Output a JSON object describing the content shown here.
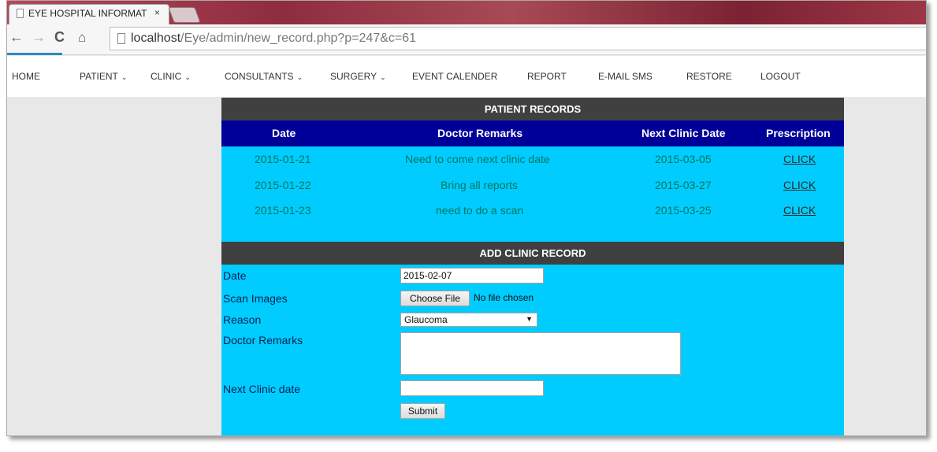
{
  "browser": {
    "tab_title": "EYE HOSPITAL INFORMAT",
    "tab_close": "×",
    "url_host": "localhost",
    "url_path": "/Eye/admin/new_record.php?p=247&c=61"
  },
  "nav": {
    "home": "HOME",
    "patient": "PATIENT",
    "clinic": "CLINIC",
    "consultants": "CONSULTANTS",
    "surgery": "SURGERY",
    "event_calender": "EVENT CALENDER",
    "report": "REPORT",
    "email_sms": "E-MAIL SMS",
    "restore": "RESTORE",
    "logout": "LOGOUT",
    "dropdown_glyph": "⌄"
  },
  "patient_records": {
    "title": "PATIENT RECORDS",
    "columns": [
      "Date",
      "Doctor Remarks",
      "Next Clinic Date",
      "Prescription"
    ],
    "rows": [
      {
        "date": "2015-01-21",
        "remarks": "Need to come next clinic date",
        "next": "2015-03-05",
        "prescription": "CLICK"
      },
      {
        "date": "2015-01-22",
        "remarks": "Bring all reports",
        "next": "2015-03-27",
        "prescription": "CLICK"
      },
      {
        "date": "2015-01-23",
        "remarks": "need to do a scan",
        "next": "2015-03-25",
        "prescription": "CLICK"
      }
    ]
  },
  "add_record": {
    "title": "ADD CLINIC RECORD",
    "date_label": "Date",
    "date_value": "2015-02-07",
    "scan_label": "Scan Images",
    "choose_file": "Choose File",
    "no_file": "No file chosen",
    "reason_label": "Reason",
    "reason_value": "Glaucoma",
    "remarks_label": "Doctor Remarks",
    "remarks_value": "",
    "next_label": "Next Clinic date",
    "next_value": "",
    "submit": "Submit"
  },
  "colors": {
    "content_bg": "#00ccff",
    "header_bar": "#404040",
    "column_header": "#000099"
  }
}
